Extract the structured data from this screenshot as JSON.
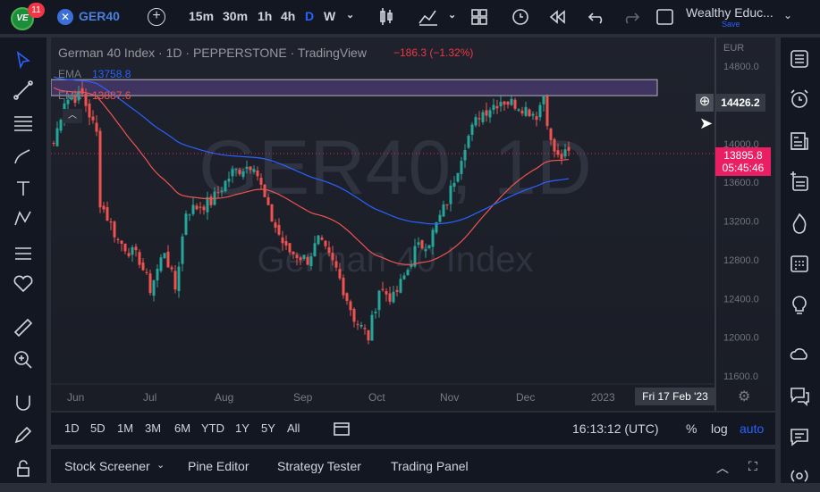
{
  "topbar": {
    "badge": "11",
    "symbol": "GER40",
    "timeframes": [
      "15m",
      "30m",
      "1h",
      "4h",
      "D",
      "W"
    ],
    "active_timeframe": "D",
    "account": "Wealthy Educ...",
    "save": "Save"
  },
  "legend": {
    "title": "German 40 Index · 1D · PEPPERSTONE · TradingView",
    "change": "−186.3 (−1.32%)",
    "ema1_label": "EMA",
    "ema1_value": "13758.8",
    "ema2_label": "EMA",
    "ema2_value": "13887.6"
  },
  "watermark": {
    "symbol": "GER40, 1D",
    "name": "German 40 Index"
  },
  "price_axis": {
    "currency": "EUR",
    "ticks": [
      "14800.0",
      "14000.0",
      "13600.0",
      "13200.0",
      "12800.0",
      "12400.0",
      "12000.0",
      "11600.0"
    ],
    "crosshair_price": "14426.2",
    "last_price": "13895.8",
    "countdown": "05:45:46"
  },
  "time_axis": {
    "ticks": [
      "Jun",
      "Jul",
      "Aug",
      "Sep",
      "Oct",
      "Nov",
      "Dec",
      "2023"
    ],
    "crosshair_date": "Fri 17 Feb '23"
  },
  "bottombar": {
    "ranges": [
      "1D",
      "5D",
      "1M",
      "3M",
      "6M",
      "YTD",
      "1Y",
      "5Y",
      "All"
    ],
    "clock": "16:13:12 (UTC)",
    "percent": "%",
    "log": "log",
    "auto": "auto"
  },
  "panels": [
    "Stock Screener",
    "Pine Editor",
    "Strategy Tester",
    "Trading Panel"
  ],
  "colors": {
    "up": "#26a69a",
    "down": "#ef5350",
    "ema_fast": "#ef5350",
    "ema_slow": "#2962ff",
    "accent": "#2962ff",
    "last_price": "#e91e63"
  },
  "chart_data": {
    "type": "candlestick",
    "ylim": [
      11600,
      14800
    ],
    "zone": [
      14495,
      14660
    ],
    "knots": [
      [
        0,
        14000
      ],
      [
        3,
        14450
      ],
      [
        8,
        14500
      ],
      [
        12,
        14100
      ],
      [
        13,
        13400
      ],
      [
        18,
        13000
      ],
      [
        24,
        12800
      ],
      [
        27,
        12500
      ],
      [
        31,
        12900
      ],
      [
        34,
        12500
      ],
      [
        37,
        13300
      ],
      [
        44,
        13400
      ],
      [
        50,
        13700
      ],
      [
        56,
        13800
      ],
      [
        60,
        13300
      ],
      [
        65,
        12900
      ],
      [
        71,
        12800
      ],
      [
        74,
        13000
      ],
      [
        79,
        12700
      ],
      [
        84,
        12200
      ],
      [
        88,
        12000
      ],
      [
        91,
        12500
      ],
      [
        95,
        12400
      ],
      [
        99,
        12700
      ],
      [
        101,
        12900
      ],
      [
        105,
        13000
      ],
      [
        110,
        13400
      ],
      [
        115,
        14000
      ],
      [
        119,
        14300
      ],
      [
        125,
        14450
      ],
      [
        130,
        14400
      ],
      [
        135,
        14300
      ],
      [
        137,
        14500
      ],
      [
        139,
        14000
      ],
      [
        141,
        13850
      ],
      [
        144,
        13895
      ]
    ]
  }
}
